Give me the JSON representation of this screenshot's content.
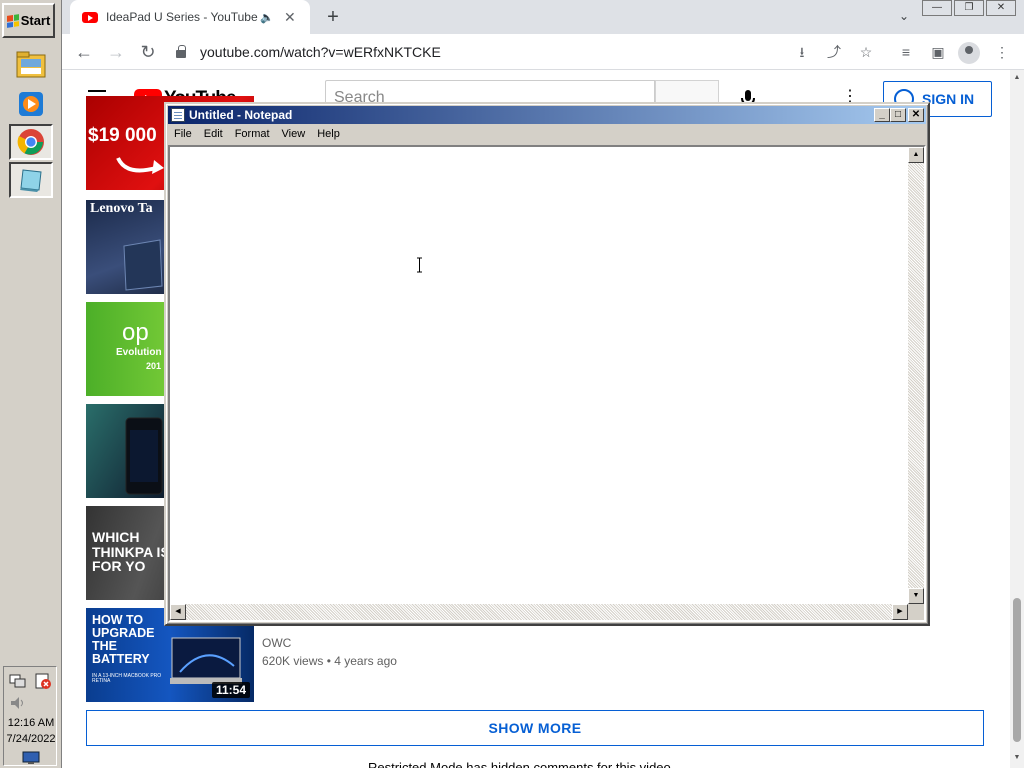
{
  "taskbar": {
    "start_label": "Start",
    "time": "12:16 AM",
    "date": "7/24/2022"
  },
  "browser": {
    "tab_title": "IdeaPad U Series - YouTube",
    "url": "youtube.com/watch?v=wERfxNKTCKE"
  },
  "youtube": {
    "logo_text": "YouTube",
    "search_placeholder": "Search",
    "signin_label": "SIGN IN",
    "thumb_texts": {
      "t1": "$19 000",
      "t2": "Lenovo Ta",
      "t3": "op",
      "t3_sub": "Evolution",
      "t3_year": "201",
      "t5": "WHICH THINKPA IS FOR YO",
      "t6": "HOW TO UPGRADE THE BATTERY",
      "t6_sub": "IN A 13-INCH MACBOOK PRO RETINA"
    },
    "last_video": {
      "channel": "OWC",
      "stats": "620K views • 4 years ago",
      "duration": "11:54"
    },
    "show_more_label": "SHOW MORE",
    "cutoff_text": "Restricted Mode has hidden comments for this video."
  },
  "notepad": {
    "title": "Untitled - Notepad",
    "menu": [
      "File",
      "Edit",
      "Format",
      "View",
      "Help"
    ],
    "content": ""
  },
  "colors": {
    "yt_red": "#ff0000",
    "link_blue": "#065fd4",
    "win_title_start": "#0a246a",
    "win_title_end": "#a6caf0",
    "win_face": "#d4d0c8"
  }
}
